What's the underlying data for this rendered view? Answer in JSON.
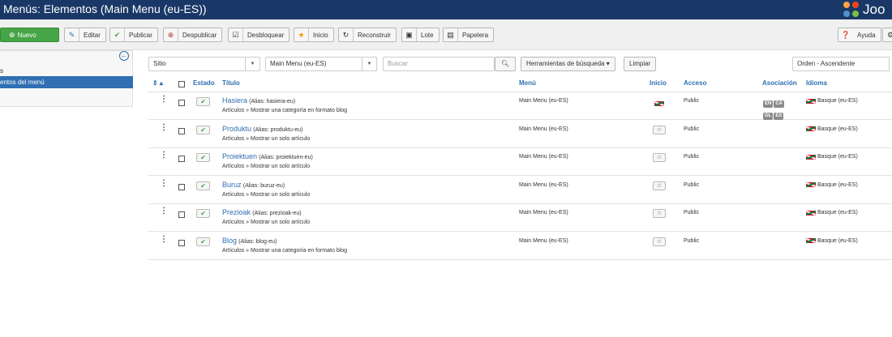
{
  "header": {
    "title": "Menús: Elementos (Main Menu (eu-ES))",
    "logo_text": "Joo"
  },
  "toolbar": {
    "nuevo": "Nuevo",
    "editar": "Editar",
    "publicar": "Publicar",
    "despublicar": "Despublicar",
    "desbloquear": "Desbloquear",
    "inicio": "Inicio",
    "reconstruir": "Reconstruir",
    "lote": "Lote",
    "papelera": "Papelera",
    "ayuda": "Ayuda"
  },
  "sidebar": {
    "items": [
      {
        "label": "s"
      },
      {
        "label": "entos del menú",
        "active": true
      }
    ]
  },
  "filters": {
    "site": "Sitio",
    "menu": "Main Menu (eu-ES)",
    "search_placeholder": "Buscar",
    "search_tools": "Herramientas de búsqueda ▾",
    "clear": "Limpiar",
    "ordering": "Orden - Ascendente"
  },
  "table": {
    "columns": {
      "sort": "⇕ ▴",
      "status": "Estado",
      "title": "Título",
      "menu": "Menú",
      "home": "Inicio",
      "access": "Acceso",
      "association": "Asociación",
      "language": "Idioma"
    },
    "rows": [
      {
        "title": "Hasiera",
        "alias": "(Alias: hasiera-eu)",
        "type": "Artículos » Mostrar una categoría en formato blog",
        "menu": "Main Menu (eu-ES)",
        "access": "Public",
        "language": "Basque (eu-ES)",
        "home": true,
        "associations": [
          "EN",
          "CA",
          "GL",
          "ES"
        ]
      },
      {
        "title": "Produktu",
        "alias": "(Alias: produktu-eu)",
        "type": "Artículos » Mostrar un solo artículo",
        "menu": "Main Menu (eu-ES)",
        "access": "Public",
        "language": "Basque (eu-ES)",
        "home": false,
        "associations": []
      },
      {
        "title": "Proiektuen",
        "alias": "(Alias: proiektuen-eu)",
        "type": "Artículos » Mostrar un solo artículo",
        "menu": "Main Menu (eu-ES)",
        "access": "Public",
        "language": "Basque (eu-ES)",
        "home": false,
        "associations": []
      },
      {
        "title": "Buruz",
        "alias": "(Alias: buruz-eu)",
        "type": "Artículos » Mostrar un solo artículo",
        "menu": "Main Menu (eu-ES)",
        "access": "Public",
        "language": "Basque (eu-ES)",
        "home": false,
        "associations": []
      },
      {
        "title": "Prezioak",
        "alias": "(Alias: prezioak-eu)",
        "type": "Artículos » Mostrar un solo artículo",
        "menu": "Main Menu (eu-ES)",
        "access": "Public",
        "language": "Basque (eu-ES)",
        "home": false,
        "associations": []
      },
      {
        "title": "Blog",
        "alias": "(Alias: blog-eu)",
        "type": "Artículos » Mostrar una categoría en formato blog",
        "menu": "Main Menu (eu-ES)",
        "access": "Public",
        "language": "Basque (eu-ES)",
        "home": false,
        "associations": []
      }
    ]
  },
  "colors": {
    "header_bg": "#1a3867",
    "accent": "#2f6fb2",
    "new_button": "#46a546"
  }
}
